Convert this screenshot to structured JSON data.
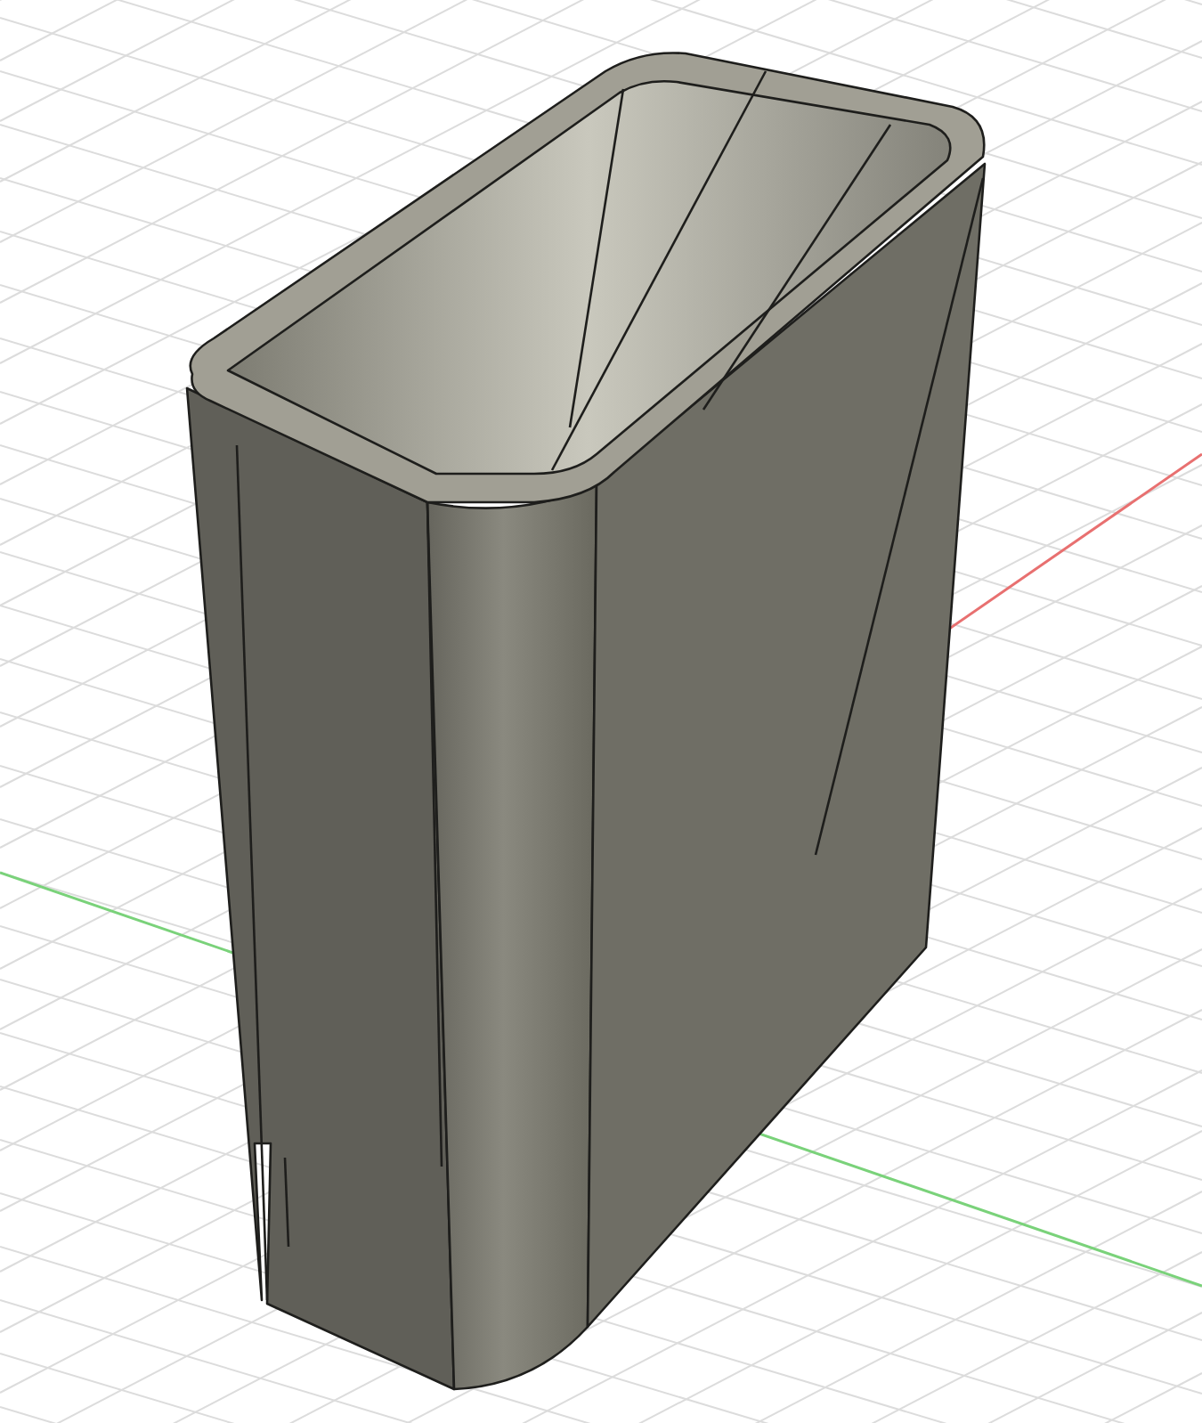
{
  "viewport": {
    "axes": [
      {
        "kind": "x",
        "color": "#e87070"
      },
      {
        "kind": "y",
        "color": "#7ad27a"
      }
    ]
  }
}
